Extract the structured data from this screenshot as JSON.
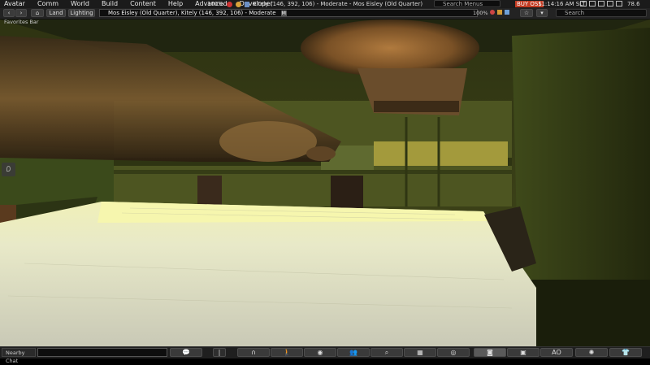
{
  "menubar": {
    "items": [
      "Avatar",
      "Comm",
      "World",
      "Build",
      "Content",
      "Help",
      "Advanced",
      "Developer"
    ],
    "zoom": "100%",
    "region_info": "Kitely (146, 392, 106) - Moderate - Mos Eisley (Old Quarter)",
    "search_placeholder": "Search Menus",
    "buy_label": "BUY OS$",
    "time": "11:14:16 AM SLT",
    "fps": "78.6"
  },
  "navbar": {
    "land_label": "Land",
    "lighting_label": "Lighting",
    "location": "Mos Eisley (Old Quarter), Kitely (146, 392, 106) - Moderate",
    "maturity_badge": "M",
    "zoom": "100%",
    "search_placeholder": "Search"
  },
  "favorites": {
    "label": "Favorites Bar"
  },
  "bottombar": {
    "chat_label": "Nearby Chat",
    "ao_label": "AO",
    "buttons": [
      "chat-icon",
      "microphone-icon",
      "headphones-icon",
      "walk-icon",
      "eye-icon",
      "people-icon",
      "search-icon",
      "map-icon",
      "minimap-icon",
      "camera-icon",
      "inventory-icon",
      "ao-label",
      "avatar-icon",
      "appearance-icon"
    ]
  },
  "colors": {
    "menubar_bg": "#1b1b1b",
    "buy_button": "#c23b22",
    "scene_wall": "#3a3d17",
    "paper_light": "#f3f2b2"
  }
}
